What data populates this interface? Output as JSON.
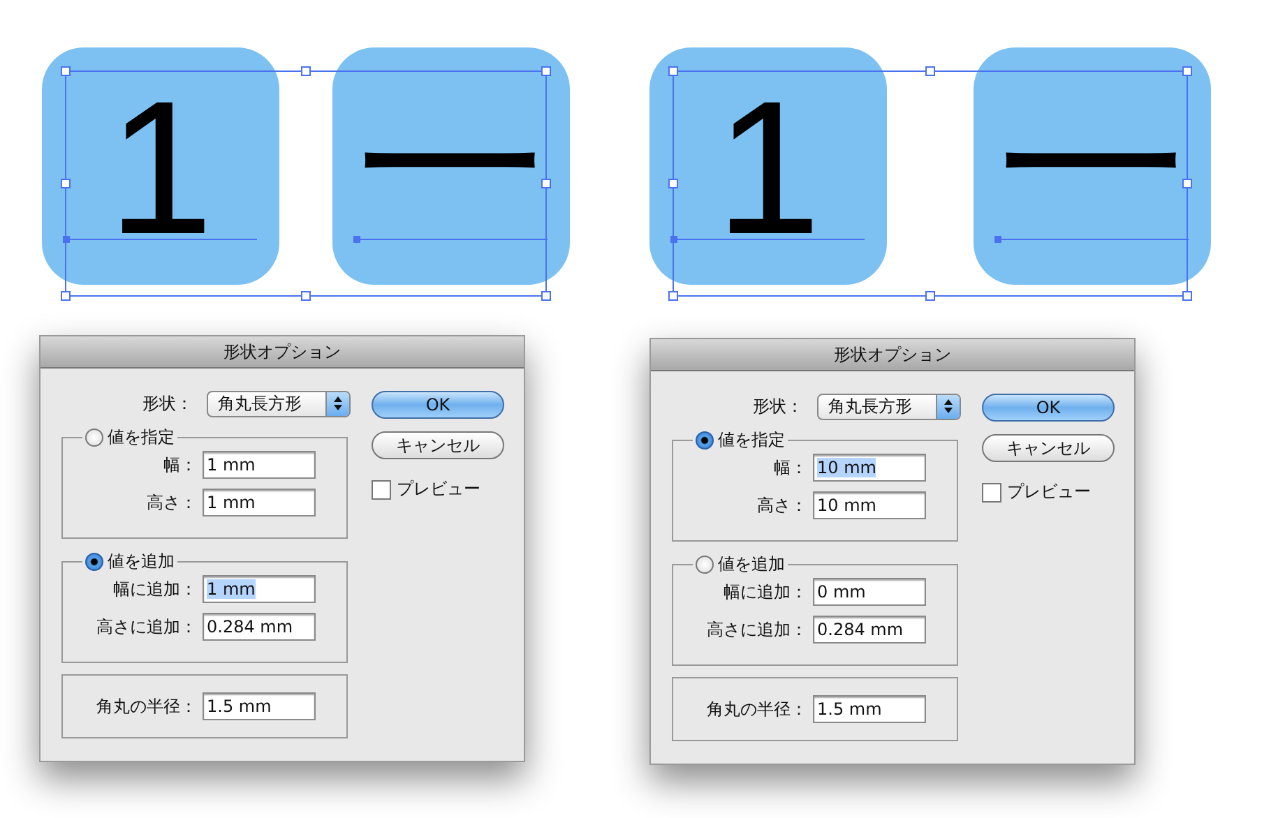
{
  "panels": [
    {
      "artwork": {
        "tiles": [
          {
            "glyph": "1"
          },
          {
            "glyph": "一"
          }
        ]
      },
      "dialog": {
        "title": "形状オプション",
        "shape": {
          "label": "形状：",
          "value": "角丸長方形"
        },
        "groups": [
          {
            "kind": "radio",
            "label": "値を指定",
            "selected": false,
            "fields": [
              {
                "label": "幅：",
                "value": "1 mm",
                "highlighted": false
              },
              {
                "label": "高さ：",
                "value": "1 mm",
                "highlighted": false
              }
            ]
          },
          {
            "kind": "radio",
            "label": "値を追加",
            "selected": true,
            "fields": [
              {
                "label": "幅に追加：",
                "value": "1 mm",
                "highlighted": true
              },
              {
                "label": "高さに追加：",
                "value": "0.284 mm",
                "highlighted": false
              }
            ]
          },
          {
            "kind": "plain",
            "fields": [
              {
                "label": "角丸の半径：",
                "value": "1.5 mm",
                "highlighted": false
              }
            ]
          }
        ],
        "buttons": [
          {
            "label": "OK",
            "default": true
          },
          {
            "label": "キャンセル",
            "default": false
          }
        ],
        "preview": {
          "label": "プレビュー",
          "checked": false
        }
      }
    },
    {
      "artwork": {
        "tiles": [
          {
            "glyph": "1"
          },
          {
            "glyph": "一"
          }
        ]
      },
      "dialog": {
        "title": "形状オプション",
        "shape": {
          "label": "形状：",
          "value": "角丸長方形"
        },
        "groups": [
          {
            "kind": "radio",
            "label": "値を指定",
            "selected": true,
            "fields": [
              {
                "label": "幅：",
                "value": "10 mm",
                "highlighted": true
              },
              {
                "label": "高さ：",
                "value": "10 mm",
                "highlighted": false
              }
            ]
          },
          {
            "kind": "radio",
            "label": "値を追加",
            "selected": false,
            "fields": [
              {
                "label": "幅に追加：",
                "value": "0 mm",
                "highlighted": false
              },
              {
                "label": "高さに追加：",
                "value": "0.284 mm",
                "highlighted": false
              }
            ]
          },
          {
            "kind": "plain",
            "fields": [
              {
                "label": "角丸の半径：",
                "value": "1.5 mm",
                "highlighted": false
              }
            ]
          }
        ],
        "buttons": [
          {
            "label": "OK",
            "default": true
          },
          {
            "label": "キャンセル",
            "default": false
          }
        ],
        "preview": {
          "label": "プレビュー",
          "checked": false
        }
      }
    }
  ]
}
